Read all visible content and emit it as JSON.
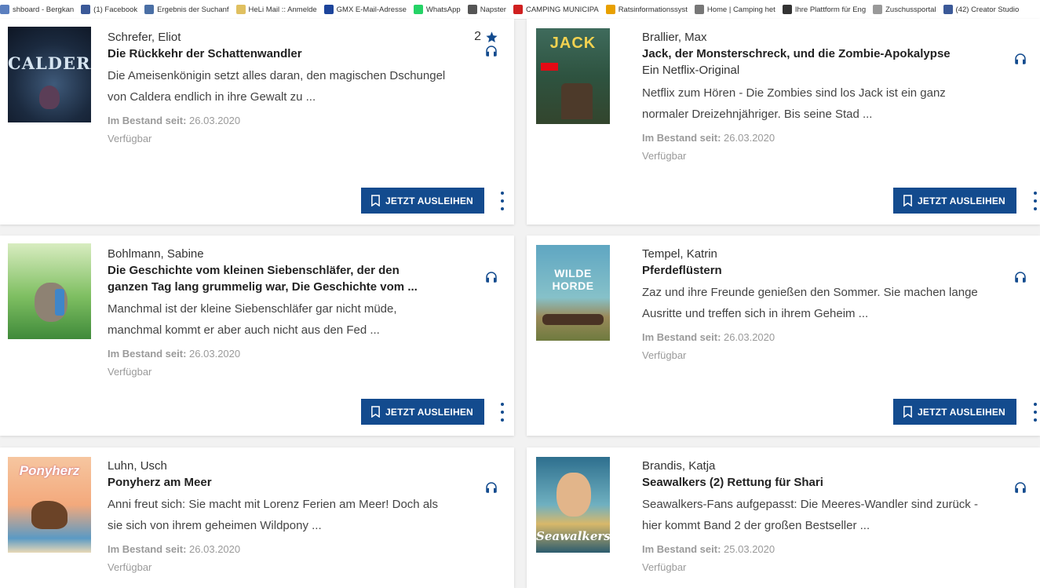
{
  "bookmarks": [
    {
      "label": "shboard - Bergkan",
      "icon": "dashboard-icon",
      "color": "#5b7fbf"
    },
    {
      "label": "(1) Facebook",
      "icon": "facebook-icon",
      "color": "#3b5998"
    },
    {
      "label": "Ergebnis der Suchanf",
      "icon": "search-result-icon",
      "color": "#4a6fa5"
    },
    {
      "label": "HeLi Mail :: Anmelde",
      "icon": "mail-icon",
      "color": "#e0c060"
    },
    {
      "label": "GMX E-Mail-Adresse",
      "icon": "gmx-icon",
      "color": "#1c449b"
    },
    {
      "label": "WhatsApp",
      "icon": "whatsapp-icon",
      "color": "#25d366"
    },
    {
      "label": "Napster",
      "icon": "napster-icon",
      "color": "#555555"
    },
    {
      "label": "CAMPING MUNICIPA",
      "icon": "camping-icon",
      "color": "#d02020"
    },
    {
      "label": "Ratsinformationssyst",
      "icon": "rats-icon",
      "color": "#e8a000"
    },
    {
      "label": "Home | Camping het",
      "icon": "home-icon",
      "color": "#777777"
    },
    {
      "label": "Ihre Plattform für Eng",
      "icon": "platform-icon",
      "color": "#333333"
    },
    {
      "label": "Zuschussportal",
      "icon": "portal-icon",
      "color": "#999999"
    },
    {
      "label": "(42) Creator Studio",
      "icon": "creator-studio-icon",
      "color": "#3b5998"
    }
  ],
  "button_label": "JETZT AUSLEIHEN",
  "meta_label": "Im Bestand seit:",
  "accent_color": "#134b8e",
  "items": [
    {
      "author": "Schrefer, Eliot",
      "title": "Die Rückkehr der Schattenwandler",
      "subtitle": "",
      "desc1": "Die Ameisenkönigin setzt alles daran, den magischen Dschungel",
      "desc2": "von Caldera endlich in ihre Gewalt zu ...",
      "date": "26.03.2020",
      "status": "Verfügbar",
      "rating": "2",
      "cover_text": "CALDERA"
    },
    {
      "author": "Brallier, Max",
      "title": "Jack, der Monsterschreck, und die Zombie-Apokalypse",
      "subtitle": "Ein Netflix-Original",
      "desc1": "Netflix zum Hören - Die Zombies sind los Jack ist ein ganz",
      "desc2": "normaler Dreizehnjähriger. Bis seine Stad ...",
      "date": "26.03.2020",
      "status": "Verfügbar",
      "cover_text": "JACK"
    },
    {
      "author": "Bohlmann, Sabine",
      "title1": "Die Geschichte vom kleinen Siebenschläfer, der den",
      "title2": "ganzen Tag lang grummelig war, Die Geschichte vom ...",
      "desc1": "Manchmal ist der kleine Siebenschläfer gar nicht müde,",
      "desc2": "manchmal kommt er aber auch nicht aus den Fed ...",
      "date": "26.03.2020",
      "status": "Verfügbar"
    },
    {
      "author": "Tempel, Katrin",
      "title": "Pferdeflüstern",
      "desc1": "Zaz und ihre Freunde genießen den Sommer. Sie machen lange",
      "desc2": "Ausritte und treffen sich in ihrem Geheim ...",
      "date": "26.03.2020",
      "status": "Verfügbar",
      "cover_text": "WILDE HORDE"
    },
    {
      "author": "Luhn, Usch",
      "title": "Ponyherz am Meer",
      "desc1": "Anni freut sich: Sie macht mit Lorenz Ferien am Meer! Doch als",
      "desc2": "sie sich von ihrem geheimen Wildpony ...",
      "date": "26.03.2020",
      "status": "Verfügbar",
      "cover_text": "Ponyherz"
    },
    {
      "author": "Brandis, Katja",
      "title": "Seawalkers (2) Rettung für Shari",
      "desc1": "Seawalkers-Fans aufgepasst: Die Meeres-Wandler sind zurück -",
      "desc2": "hier kommt Band 2 der großen Bestseller ...",
      "date": "25.03.2020",
      "status": "Verfügbar",
      "cover_text": "Seawalkers"
    }
  ]
}
